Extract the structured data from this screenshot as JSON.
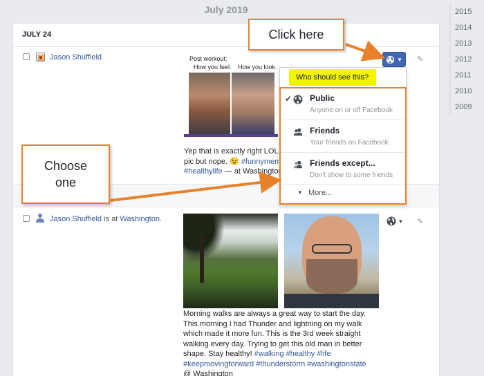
{
  "timeline": {
    "month_title": "July 2019",
    "years": [
      "2015",
      "2014",
      "2013",
      "2012",
      "2011",
      "2010",
      "2009"
    ]
  },
  "day": {
    "label": "JULY 24"
  },
  "post1": {
    "author": "Jason Shuffield",
    "meme_title": "Post workout:",
    "meme_left": "How you feel.",
    "meme_right": "How you look.",
    "caption_text": "Yep that is exactly right LOL.",
    "caption_line2": "pic but nope. 😉",
    "tag1": "#funnymem",
    "tag2": "#healthylife",
    "location_suffix": "— at Washington"
  },
  "post2": {
    "author": "Jason Shuffield",
    "is_at": "is at",
    "place": "Washington.",
    "caption_lines": [
      "Morning walks are always a great way to start the day.",
      "This morning I had Thunder and lightning on my walk",
      "which made it more fun. This is the 3rd week straight",
      "walking every day. Trying to get this old man in better",
      "shape. Stay healthy!"
    ],
    "tags_line1": [
      "#walking",
      "#healthy",
      "#life"
    ],
    "tags_line2": [
      "#keepmovingforward",
      "#thunderstorm",
      "#washingtonstate"
    ],
    "location": "@ Washington"
  },
  "audience_menu": {
    "header": "Who should see this?",
    "options": [
      {
        "title": "Public",
        "subtitle": "Anyone on or off Facebook",
        "selected": true,
        "icon": "globe-icon"
      },
      {
        "title": "Friends",
        "subtitle": "Your friends on Facebook",
        "selected": false,
        "icon": "friends-icon"
      },
      {
        "title": "Friends except...",
        "subtitle": "Don't show to some friends",
        "selected": false,
        "icon": "friends-except-icon"
      }
    ],
    "more_label": "More..."
  },
  "callouts": {
    "click_here": "Click here",
    "choose_one_line1": "Choose",
    "choose_one_line2": "one"
  },
  "colors": {
    "accent_orange": "#e8822a",
    "link_blue": "#365899",
    "button_blue": "#4267b2",
    "highlight_yellow": "#f4f300"
  }
}
